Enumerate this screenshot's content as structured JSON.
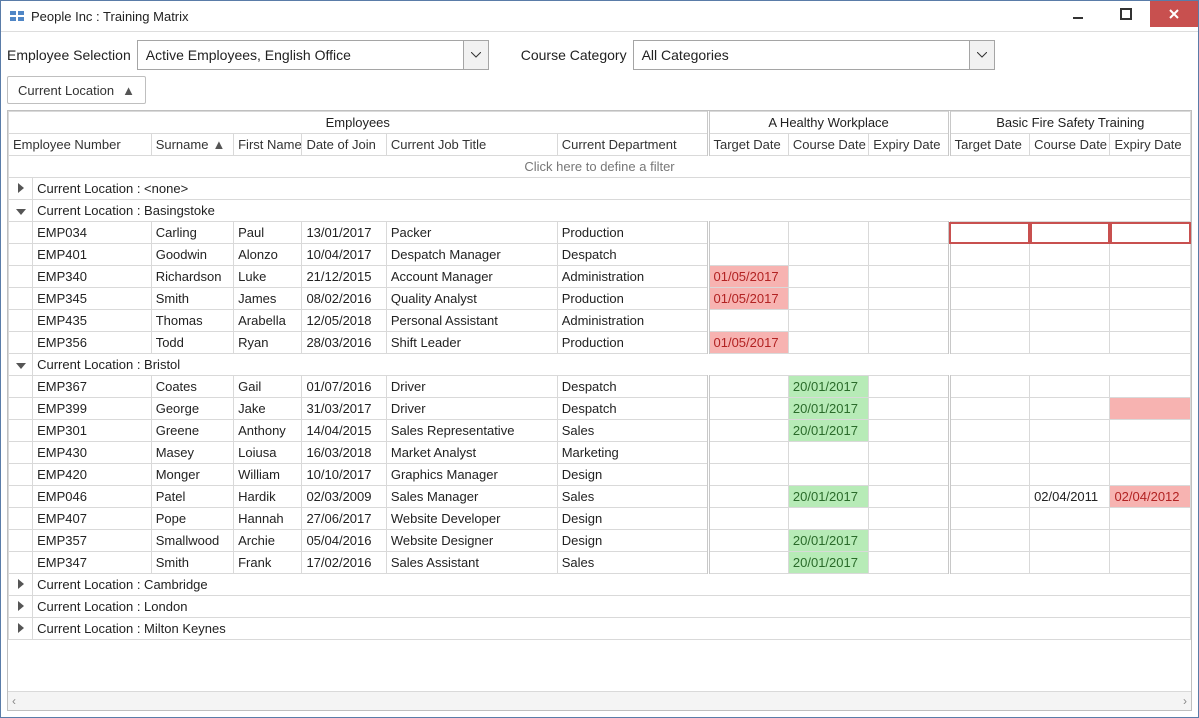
{
  "window": {
    "title": "People Inc : Training Matrix"
  },
  "toolbar": {
    "emp_sel_label": "Employee Selection",
    "emp_sel_value": "Active Employees, English Office",
    "cat_label": "Course Category",
    "cat_value": "All Categories"
  },
  "groupchip": {
    "label": "Current Location",
    "dir": "▲"
  },
  "header": {
    "band_emp": "Employees",
    "band_course1": "A Healthy Workplace",
    "band_course2": "Basic Fire Safety Training",
    "cols": {
      "emp_no": "Employee Number",
      "surname": "Surname",
      "first_name": "First Name",
      "doj": "Date of Join",
      "job": "Current Job Title",
      "dept": "Current Department",
      "target": "Target Date",
      "course": "Course Date",
      "expiry": "Expiry Date"
    },
    "sort_arrow": "▲"
  },
  "filter_hint": "Click here to define a filter",
  "groups": [
    {
      "label": "Current Location : <none>",
      "expanded": false,
      "rows": []
    },
    {
      "label": "Current Location : Basingstoke",
      "expanded": true,
      "rows": [
        {
          "emp": "EMP034",
          "sur": "Carling",
          "fn": "Paul",
          "doj": "13/01/2017",
          "job": "Packer",
          "dept": "Production",
          "c1": {
            "t": "",
            "c": "",
            "e": ""
          },
          "c2": {
            "t": "",
            "c": "",
            "e": ""
          },
          "selected": true
        },
        {
          "emp": "EMP401",
          "sur": "Goodwin",
          "fn": "Alonzo",
          "doj": "10/04/2017",
          "job": "Despatch Manager",
          "dept": "Despatch",
          "c1": {
            "t": "",
            "c": "",
            "e": ""
          },
          "c2": {
            "t": "",
            "c": "",
            "e": ""
          }
        },
        {
          "emp": "EMP340",
          "sur": "Richardson",
          "fn": "Luke",
          "doj": "21/12/2015",
          "job": "Account Manager",
          "dept": "Administration",
          "c1": {
            "t": "01/05/2017",
            "t_hl": "red",
            "c": "",
            "e": ""
          },
          "c2": {
            "t": "",
            "c": "",
            "e": ""
          }
        },
        {
          "emp": "EMP345",
          "sur": "Smith",
          "fn": "James",
          "doj": "08/02/2016",
          "job": "Quality Analyst",
          "dept": "Production",
          "c1": {
            "t": "01/05/2017",
            "t_hl": "red",
            "c": "",
            "e": ""
          },
          "c2": {
            "t": "",
            "c": "",
            "e": ""
          }
        },
        {
          "emp": "EMP435",
          "sur": "Thomas",
          "fn": "Arabella",
          "doj": "12/05/2018",
          "job": "Personal Assistant",
          "dept": "Administration",
          "c1": {
            "t": "",
            "c": "",
            "e": ""
          },
          "c2": {
            "t": "",
            "c": "",
            "e": ""
          }
        },
        {
          "emp": "EMP356",
          "sur": "Todd",
          "fn": "Ryan",
          "doj": "28/03/2016",
          "job": "Shift Leader",
          "dept": "Production",
          "c1": {
            "t": "01/05/2017",
            "t_hl": "red",
            "c": "",
            "e": ""
          },
          "c2": {
            "t": "",
            "c": "",
            "e": ""
          }
        }
      ]
    },
    {
      "label": "Current Location : Bristol",
      "expanded": true,
      "rows": [
        {
          "emp": "EMP367",
          "sur": "Coates",
          "fn": "Gail",
          "doj": "01/07/2016",
          "job": "Driver",
          "dept": "Despatch",
          "c1": {
            "t": "",
            "c": "20/01/2017",
            "c_hl": "green",
            "e": ""
          },
          "c2": {
            "t": "",
            "c": "",
            "e": ""
          }
        },
        {
          "emp": "EMP399",
          "sur": "George",
          "fn": "Jake",
          "doj": "31/03/2017",
          "job": "Driver",
          "dept": "Despatch",
          "c1": {
            "t": "",
            "c": "20/01/2017",
            "c_hl": "green",
            "e": ""
          },
          "c2": {
            "t": "",
            "c": "",
            "e": "",
            "e_hl": "red"
          }
        },
        {
          "emp": "EMP301",
          "sur": "Greene",
          "fn": "Anthony",
          "doj": "14/04/2015",
          "job": "Sales Representative",
          "dept": "Sales",
          "c1": {
            "t": "",
            "c": "20/01/2017",
            "c_hl": "green",
            "e": ""
          },
          "c2": {
            "t": "",
            "c": "",
            "e": ""
          }
        },
        {
          "emp": "EMP430",
          "sur": "Masey",
          "fn": "Loiusa",
          "doj": "16/03/2018",
          "job": "Market Analyst",
          "dept": "Marketing",
          "c1": {
            "t": "",
            "c": "",
            "e": ""
          },
          "c2": {
            "t": "",
            "c": "",
            "e": ""
          }
        },
        {
          "emp": "EMP420",
          "sur": "Monger",
          "fn": "William",
          "doj": "10/10/2017",
          "job": "Graphics Manager",
          "dept": "Design",
          "c1": {
            "t": "",
            "c": "",
            "e": ""
          },
          "c2": {
            "t": "",
            "c": "",
            "e": ""
          }
        },
        {
          "emp": "EMP046",
          "sur": "Patel",
          "fn": "Hardik",
          "doj": "02/03/2009",
          "job": "Sales Manager",
          "dept": "Sales",
          "c1": {
            "t": "",
            "c": "20/01/2017",
            "c_hl": "green",
            "e": ""
          },
          "c2": {
            "t": "",
            "c": "02/04/2011",
            "e": "02/04/2012",
            "e_hl": "red"
          }
        },
        {
          "emp": "EMP407",
          "sur": "Pope",
          "fn": "Hannah",
          "doj": "27/06/2017",
          "job": "Website Developer",
          "dept": "Design",
          "c1": {
            "t": "",
            "c": "",
            "e": ""
          },
          "c2": {
            "t": "",
            "c": "",
            "e": ""
          }
        },
        {
          "emp": "EMP357",
          "sur": "Smallwood",
          "fn": "Archie",
          "doj": "05/04/2016",
          "job": "Website Designer",
          "dept": "Design",
          "c1": {
            "t": "",
            "c": "20/01/2017",
            "c_hl": "green",
            "e": ""
          },
          "c2": {
            "t": "",
            "c": "",
            "e": ""
          }
        },
        {
          "emp": "EMP347",
          "sur": "Smith",
          "fn": "Frank",
          "doj": "17/02/2016",
          "job": "Sales Assistant",
          "dept": "Sales",
          "c1": {
            "t": "",
            "c": "20/01/2017",
            "c_hl": "green",
            "e": ""
          },
          "c2": {
            "t": "",
            "c": "",
            "e": ""
          }
        }
      ]
    },
    {
      "label": "Current Location : Cambridge",
      "expanded": false,
      "rows": []
    },
    {
      "label": "Current Location : London",
      "expanded": false,
      "rows": []
    },
    {
      "label": "Current Location : Milton Keynes",
      "expanded": false,
      "rows": []
    }
  ]
}
